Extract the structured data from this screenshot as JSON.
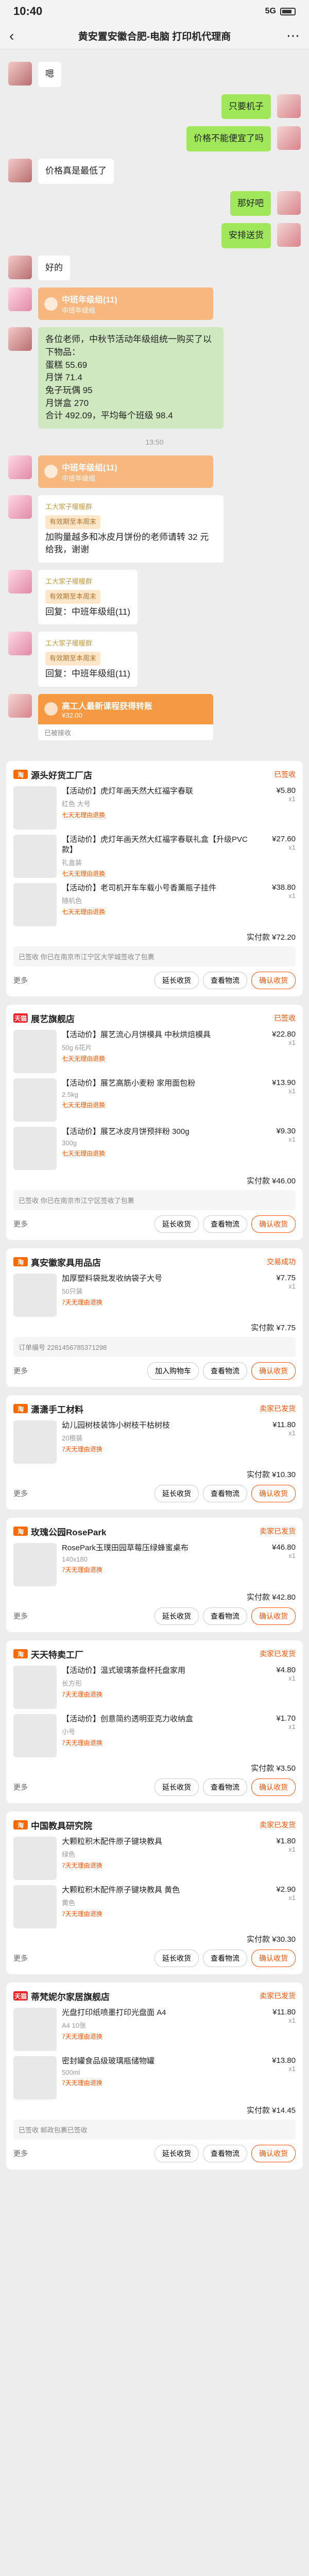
{
  "status": {
    "time": "10:40",
    "signal": "5G",
    "battery": "80"
  },
  "nav": {
    "title": "黄安置安徽合肥-电脑 打印机代理商"
  },
  "chat1": [
    {
      "side": "left",
      "text": "嗯"
    },
    {
      "side": "right",
      "text": "只要机子"
    },
    {
      "side": "right",
      "text": "价格不能便宜了吗"
    },
    {
      "side": "left",
      "text": "价格真是最低了"
    },
    {
      "side": "right",
      "text": "那好吧"
    },
    {
      "side": "right",
      "text": "安排送货"
    },
    {
      "side": "left",
      "text": "好的"
    }
  ],
  "card1": {
    "title": "中班年级组(11)",
    "sub": "中班年级组"
  },
  "broadcast": {
    "text": "各位老师，中秋节活动年级组统一购买了以下物品：\n蛋糕 55.69\n月饼 71.4\n兔子玩偶 95\n月饼盒 270\n合计 492.09，平均每个班级 98.4"
  },
  "time2": "13:50",
  "card2": {
    "title": "中班年级组(11)",
    "sub": "中班年级组"
  },
  "notices": [
    {
      "hdr": "工大家子暖暖群",
      "tag": "有效期至本周末",
      "text": "加购量越多和冰皮月饼份的老师请转 32 元给我，谢谢"
    },
    {
      "hdr": "工大家子暖暖群",
      "tag": "有效期至本周末",
      "text": "回复：中班年级组(11)"
    },
    {
      "hdr": "工大家子暖暖群",
      "tag": "有效期至本周末",
      "text": "回复：中班年级组(11)"
    }
  ],
  "transfer": {
    "title": "高工人最新课程获得转账",
    "amount": "¥32.00",
    "note": "已被接收"
  },
  "orders": [
    {
      "shop": "源头好货工厂店",
      "logo": "淘",
      "status": "已签收",
      "items": [
        {
          "name": "【活动价】虎灯年画天然大红福字春联",
          "spec": "红色 大号",
          "tags": "七天无理由退换",
          "price": "¥5.80",
          "qty": "x1"
        },
        {
          "name": "【活动价】虎灯年画天然大红福字春联礼盒【升级PVC款】",
          "spec": "礼盒装",
          "tags": "七天无理由退换",
          "price": "¥27.60",
          "qty": "x1"
        },
        {
          "name": "【活动价】老司机开车车载小号香薰瓶子挂件",
          "spec": "随机色",
          "tags": "七天无理由退换",
          "price": "¥38.80",
          "qty": "x1"
        }
      ],
      "total": "实付款 ¥72.20",
      "more": "更多",
      "buttons": [
        "延长收货",
        "查看物流",
        "确认收货"
      ],
      "note": "已签收  你已在南京市江宁区大学城签收了包裹"
    },
    {
      "shop": "展艺旗舰店",
      "logo": "天猫",
      "status": "已签收",
      "items": [
        {
          "name": "【活动价】展艺流心月饼模具 中秋烘焙模具",
          "spec": "50g 6花片",
          "tags": "七天无理由退换",
          "price": "¥22.80",
          "qty": "x1"
        },
        {
          "name": "【活动价】展艺高筋小麦粉 家用面包粉",
          "spec": "2.5kg",
          "tags": "七天无理由退换",
          "price": "¥13.90",
          "qty": "x1"
        },
        {
          "name": "【活动价】展艺冰皮月饼预拌粉 300g",
          "spec": "300g",
          "tags": "七天无理由退换",
          "price": "¥9.30",
          "qty": "x1"
        }
      ],
      "total": "实付款 ¥46.00",
      "more": "更多",
      "buttons": [
        "延长收货",
        "查看物流",
        "确认收货"
      ],
      "note": "已签收  你已在南京市江宁区签收了包裹"
    },
    {
      "shop": "真安徽家具用品店",
      "logo": "淘",
      "status": "交易成功",
      "items": [
        {
          "name": "加厚塑料袋批发收纳袋子大号",
          "spec": "50只装",
          "tags": "7天无理由退换",
          "price": "¥7.75",
          "qty": "x1"
        }
      ],
      "total": "实付款 ¥7.75",
      "more": "更多",
      "buttons": [
        "加入购物车",
        "查看物流",
        "确认收货"
      ],
      "note": "订单编号 2281456785371298"
    },
    {
      "shop": "潇潇手工材料",
      "logo": "淘",
      "status": "卖家已发货",
      "items": [
        {
          "name": "幼儿园树枝装饰小树枝干枯树枝",
          "spec": "20根装",
          "tags": "7天无理由退换",
          "price": "¥11.80",
          "qty": "x1"
        }
      ],
      "total": "实付款 ¥10.30",
      "more": "更多",
      "buttons": [
        "延长收货",
        "查看物流",
        "确认收货"
      ],
      "note": ""
    },
    {
      "shop": "玫瑰公园RosePark",
      "logo": "淘",
      "status": "卖家已发货",
      "items": [
        {
          "name": "RosePark玉璞田园草莓压绿蜂蜜桌布",
          "spec": "140x180",
          "tags": "7天无理由退换",
          "price": "¥46.80",
          "qty": "x1"
        }
      ],
      "total": "实付款 ¥42.80",
      "more": "更多",
      "buttons": [
        "延长收货",
        "查看物流",
        "确认收货"
      ],
      "note": ""
    },
    {
      "shop": "天天特卖工厂",
      "logo": "淘",
      "status": "卖家已发货",
      "items": [
        {
          "name": "【活动价】温式玻璃茶盘杯托盘家用",
          "spec": "长方形",
          "tags": "7天无理由退换",
          "price": "¥4.80",
          "qty": "x1"
        },
        {
          "name": "【活动价】创意简约透明亚克力收纳盒",
          "spec": "小号",
          "tags": "7天无理由退换",
          "price": "¥1.70",
          "qty": "x1"
        }
      ],
      "total": "实付款 ¥3.50",
      "more": "更多",
      "buttons": [
        "延长收货",
        "查看物流",
        "确认收货"
      ],
      "note": ""
    },
    {
      "shop": "中国教具研究院",
      "logo": "淘",
      "status": "卖家已发货",
      "items": [
        {
          "name": "大颗粒积木配件原子键块教具",
          "spec": "绿色",
          "tags": "7天无理由退换",
          "price": "¥1.80",
          "qty": "x1"
        },
        {
          "name": "大颗粒积木配件原子键块教具 黄色",
          "spec": "黄色",
          "tags": "7天无理由退换",
          "price": "¥2.90",
          "qty": "x1"
        }
      ],
      "total": "实付款 ¥30.30",
      "more": "更多",
      "buttons": [
        "延长收货",
        "查看物流",
        "确认收货"
      ],
      "note": ""
    },
    {
      "shop": "蒂梵妮尔家居旗舰店",
      "logo": "天猫",
      "status": "卖家已发货",
      "items": [
        {
          "name": "光盘打印纸喷墨打印光盘面 A4",
          "spec": "A4 10张",
          "tags": "7天无理由退换",
          "price": "¥11.80",
          "qty": "x1"
        },
        {
          "name": "密封罐食品级玻璃瓶储物罐",
          "spec": "500ml",
          "tags": "7天无理由退换",
          "price": "¥13.80",
          "qty": "x1"
        }
      ],
      "total": "实付款 ¥14.45",
      "more": "更多",
      "buttons": [
        "延长收货",
        "查看物流",
        "确认收货"
      ],
      "note": "已签收  邮政包裹已签收"
    }
  ],
  "colors": {
    "bubble_right": "#a0e75a",
    "accent": "#ff5000",
    "tmall": "#e22222"
  }
}
